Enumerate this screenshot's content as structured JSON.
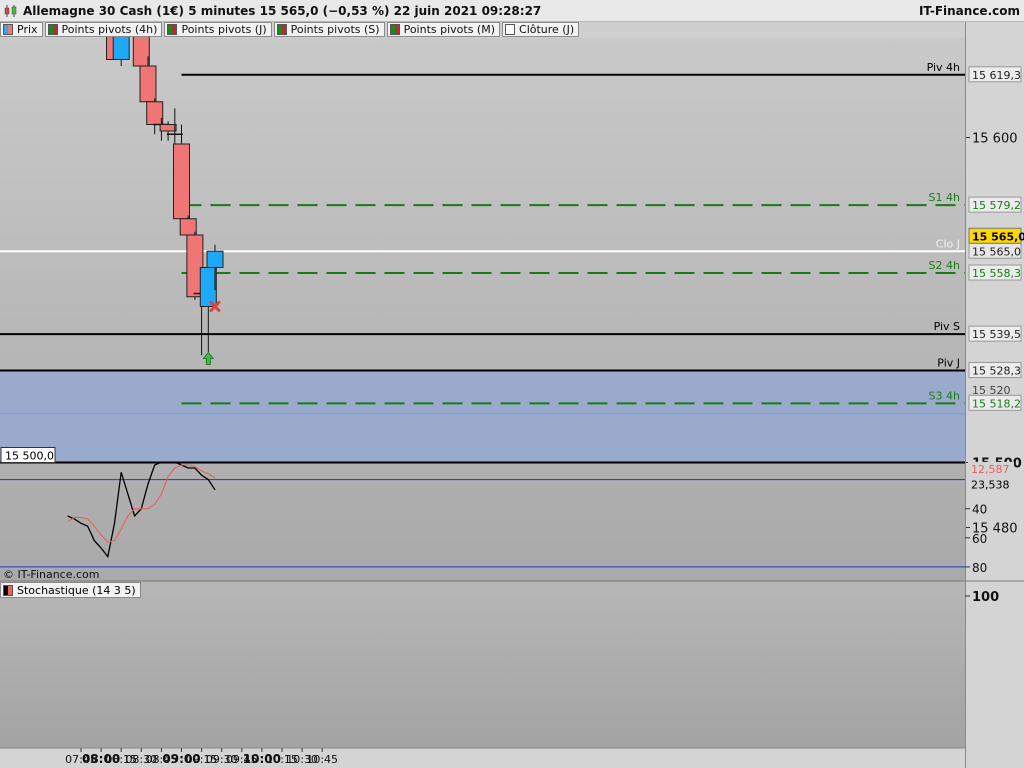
{
  "window": {
    "title": "Allemagne 30 Cash (1€) 5 minutes 15 565,0 (−0,53 %) 22 juin 2021 09:28:27",
    "brand": "IT-Finance.com",
    "chart_icon": "candlestick-chart-icon"
  },
  "legend": [
    {
      "label": "Prix",
      "color": "#3aa0f0"
    },
    {
      "label": "Points pivots (4h)",
      "color": "#1a8a1a"
    },
    {
      "label": "Points pivots (J)",
      "color": "#1a8a1a"
    },
    {
      "label": "Points pivots (S)",
      "color": "#1a8a1a"
    },
    {
      "label": "Points pivots (M)",
      "color": "#1a8a1a"
    },
    {
      "label": "Clôture (J)",
      "color": "#ffffff"
    }
  ],
  "copyright": "© IT-Finance.com",
  "stochastic_label": "Stochastique (14 3 5)",
  "colors": {
    "bull": "#1ea8f5",
    "bear": "#f07575",
    "pivot": "#000000",
    "support": "#1a7a1a",
    "close": "#ffffff",
    "band": "#9aaacc",
    "stoch_k": "#000000",
    "stoch_d": "#e86060",
    "stoch_level": "#2233cc"
  },
  "chart_data": [
    {
      "type": "candlestick",
      "x_ticks": [
        {
          "label": "07:45",
          "bold": false
        },
        {
          "label": "08:00",
          "bold": true
        },
        {
          "label": "08:15",
          "bold": false
        },
        {
          "label": "08:30",
          "bold": false
        },
        {
          "label": "08:45",
          "bold": false
        },
        {
          "label": "09:00",
          "bold": true
        },
        {
          "label": "09:15",
          "bold": false
        },
        {
          "label": "09:30",
          "bold": false
        },
        {
          "label": "09:45",
          "bold": false
        },
        {
          "label": "10:00",
          "bold": true
        },
        {
          "label": "10:15",
          "bold": false
        },
        {
          "label": "10:30",
          "bold": false
        },
        {
          "label": "10:45",
          "bold": false
        }
      ],
      "y_ticks": [
        {
          "label": "15 600",
          "value": 15600
        },
        {
          "label": "15 500",
          "value": 15500,
          "bold": true
        },
        {
          "label": "15 480",
          "value": 15480
        }
      ],
      "candles": [
        {
          "time": "08:05",
          "open": 15633,
          "high": 15640,
          "low": 15628,
          "close": 15634
        },
        {
          "time": "08:10",
          "open": 15648,
          "high": 15650,
          "low": 15624,
          "close": 15624
        },
        {
          "time": "08:15",
          "open": 15624,
          "high": 15648,
          "low": 15622,
          "close": 15640
        },
        {
          "time": "08:30",
          "open": 15648,
          "high": 15650,
          "low": 15622,
          "close": 15622
        },
        {
          "time": "08:35",
          "open": 15622,
          "high": 15625,
          "low": 15610,
          "close": 15611
        },
        {
          "time": "08:40",
          "open": 15611,
          "high": 15612,
          "low": 15601,
          "close": 15604
        },
        {
          "time": "08:45",
          "open": 15604,
          "high": 15606,
          "low": 15599,
          "close": 15604
        },
        {
          "time": "08:50",
          "open": 15604,
          "high": 15605,
          "low": 15599,
          "close": 15602
        },
        {
          "time": "08:55",
          "open": 15602,
          "high": 15609,
          "low": 15598,
          "close": 15601
        },
        {
          "time": "09:00",
          "open": 15598,
          "high": 15604,
          "low": 15575,
          "close": 15575
        },
        {
          "time": "09:05",
          "open": 15575,
          "high": 15576,
          "low": 15552,
          "close": 15570
        },
        {
          "time": "09:10",
          "open": 15570,
          "high": 15571,
          "low": 15550,
          "close": 15551
        },
        {
          "time": "09:15",
          "open": 15552,
          "high": 15555,
          "low": 15533,
          "close": 15552
        },
        {
          "time": "09:20",
          "open": 15548,
          "high": 15560,
          "low": 15534,
          "close": 15560
        },
        {
          "time": "09:25",
          "open": 15560,
          "high": 15567,
          "low": 15553,
          "close": 15565
        }
      ],
      "horizontal_levels": [
        {
          "name": "Piv 4h",
          "value": 15619.3,
          "label": "15 619,3",
          "style": "pivot-4h"
        },
        {
          "name": "S1 4h",
          "value": 15579.2,
          "label": "15 579,2",
          "style": "support"
        },
        {
          "name": "Clo J",
          "value": 15565.0,
          "label": "15 565,0",
          "style": "close"
        },
        {
          "name": "S2 4h",
          "value": 15558.3,
          "label": "15 558,3",
          "style": "support"
        },
        {
          "name": "Piv S",
          "value": 15539.5,
          "label": "15 539,5",
          "style": "pivot"
        },
        {
          "name": "Piv J",
          "value": 15528.3,
          "label": "15 528,3",
          "style": "pivot"
        },
        {
          "name": "S3 4h",
          "value": 15518.2,
          "label": "15 518,2",
          "style": "support"
        },
        {
          "name": "",
          "value": 15500.0,
          "label": "15 500,0",
          "style": "round"
        }
      ],
      "current_price": {
        "value": 15565.0,
        "label": "15 565,0"
      },
      "hidden_label": "15 520",
      "markers": [
        {
          "type": "buy-arrow",
          "time": "09:20",
          "value": 15532
        },
        {
          "type": "sell-cross",
          "time": "09:25",
          "value": 15548
        }
      ]
    },
    {
      "type": "line",
      "y_ticks": [
        {
          "label": "100",
          "value": 100
        },
        {
          "label": "80",
          "value": 80
        },
        {
          "label": "60",
          "value": 60
        },
        {
          "label": "40",
          "value": 40
        }
      ],
      "levels": [
        80,
        20
      ],
      "last_values": [
        {
          "label": "23,538",
          "value": 23.538,
          "color": "#000000"
        },
        {
          "label": "12,587",
          "value": 12.587,
          "color": "#e86060"
        }
      ],
      "x": [
        "07:35",
        "07:40",
        "07:45",
        "07:50",
        "07:55",
        "08:00",
        "08:05",
        "08:10",
        "08:15",
        "08:20",
        "08:25",
        "08:30",
        "08:35",
        "08:40",
        "08:45",
        "08:50",
        "08:55",
        "09:00",
        "09:05",
        "09:10",
        "09:15",
        "09:20",
        "09:25"
      ],
      "series": [
        {
          "values": [
            45,
            47,
            50,
            52,
            62,
            67,
            73,
            50,
            15,
            30,
            45,
            40,
            23,
            10,
            8,
            8,
            8,
            10,
            12,
            12,
            17,
            20,
            27
          ]
        },
        {
          "values": [
            49,
            46,
            46,
            47,
            52,
            58,
            63,
            62,
            54,
            45,
            40,
            40,
            40,
            37,
            30,
            18,
            12,
            10,
            10,
            11,
            14,
            16,
            19
          ]
        }
      ]
    }
  ]
}
